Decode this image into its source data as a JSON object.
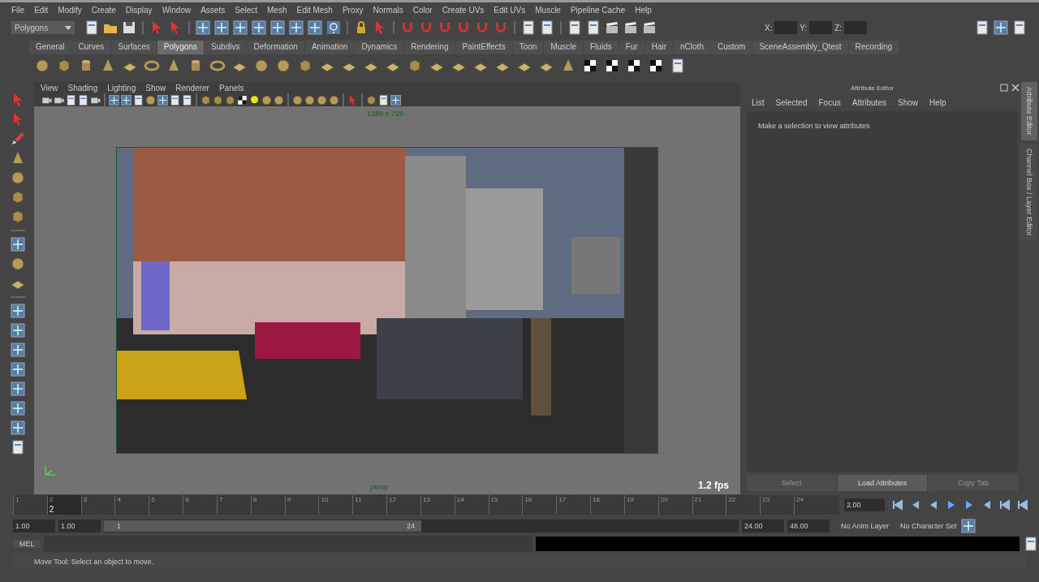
{
  "menu_bar": [
    "File",
    "Edit",
    "Modify",
    "Create",
    "Display",
    "Window",
    "Assets",
    "Select",
    "Mesh",
    "Edit Mesh",
    "Proxy",
    "Normals",
    "Color",
    "Create UVs",
    "Edit UVs",
    "Muscle",
    "Pipeline Cache",
    "Help"
  ],
  "status_line": {
    "menu_set": "Polygons",
    "coord_labels": [
      "X:",
      "Y:",
      "Z:"
    ]
  },
  "shelf": {
    "tabs": [
      {
        "label": "General",
        "selected": false
      },
      {
        "label": "Curves",
        "selected": false
      },
      {
        "label": "Surfaces",
        "selected": false
      },
      {
        "label": "Polygons",
        "selected": true
      },
      {
        "label": "Subdivs",
        "selected": false
      },
      {
        "label": "Deformation",
        "selected": false
      },
      {
        "label": "Animation",
        "selected": false
      },
      {
        "label": "Dynamics",
        "selected": false
      },
      {
        "label": "Rendering",
        "selected": false
      },
      {
        "label": "PaintEffects",
        "selected": false
      },
      {
        "label": "Toon",
        "selected": false
      },
      {
        "label": "Muscle",
        "selected": false
      },
      {
        "label": "Fluids",
        "selected": false
      },
      {
        "label": "Fur",
        "selected": false
      },
      {
        "label": "Hair",
        "selected": false
      },
      {
        "label": "nCloth",
        "selected": false
      },
      {
        "label": "Custom",
        "selected": false
      },
      {
        "label": "SceneAssembly_Qtest",
        "selected": false
      },
      {
        "label": "Recording",
        "selected": false
      }
    ]
  },
  "viewport": {
    "menu": [
      "View",
      "Shading",
      "Lighting",
      "Show",
      "Renderer",
      "Panels"
    ],
    "resolution": "1280 x 720",
    "camera": "persp",
    "fps": "1.2 fps"
  },
  "attribute_editor": {
    "title": "Attribute Editor",
    "menu": [
      "List",
      "Selected",
      "Focus",
      "Attributes",
      "Show",
      "Help"
    ],
    "message": "Make a selection to view attributes",
    "buttons": [
      {
        "label": "Select",
        "disabled": true
      },
      {
        "label": "Load Attributes",
        "disabled": false
      },
      {
        "label": "Copy Tab",
        "disabled": true
      }
    ]
  },
  "side_tabs": [
    {
      "label": "Attribute Editor",
      "selected": true
    },
    {
      "label": "Channel Box / Layer Editor",
      "selected": false
    }
  ],
  "time_slider": {
    "ticks": [
      {
        "label": "1",
        "selected": false
      },
      {
        "label": "2",
        "selected": true
      },
      {
        "label": "3",
        "selected": false
      },
      {
        "label": "4",
        "selected": false
      },
      {
        "label": "5",
        "selected": false
      },
      {
        "label": "6",
        "selected": false
      },
      {
        "label": "7",
        "selected": false
      },
      {
        "label": "8",
        "selected": false
      },
      {
        "label": "9",
        "selected": false
      },
      {
        "label": "10",
        "selected": false
      },
      {
        "label": "11",
        "selected": false
      },
      {
        "label": "12",
        "selected": false
      },
      {
        "label": "13",
        "selected": false
      },
      {
        "label": "14",
        "selected": false
      },
      {
        "label": "15",
        "selected": false
      },
      {
        "label": "16",
        "selected": false
      },
      {
        "label": "17",
        "selected": false
      },
      {
        "label": "18",
        "selected": false
      },
      {
        "label": "19",
        "selected": false
      },
      {
        "label": "20",
        "selected": false
      },
      {
        "label": "21",
        "selected": false
      },
      {
        "label": "22",
        "selected": false
      },
      {
        "label": "23",
        "selected": false
      },
      {
        "label": "24",
        "selected": false
      }
    ],
    "current_frame": "2",
    "current_time": "2.00"
  },
  "range_slider": {
    "level": 0.5,
    "start": "1.00",
    "playback_start": "1.00",
    "range_start": "1",
    "range_end": "24",
    "playback_end": "24.00",
    "end": "48.00",
    "anim_layer": "No Anim Layer",
    "character_set": "No Character Set"
  },
  "command_line": {
    "label": "MEL"
  },
  "help_line": "Move Tool: Select an object to move."
}
